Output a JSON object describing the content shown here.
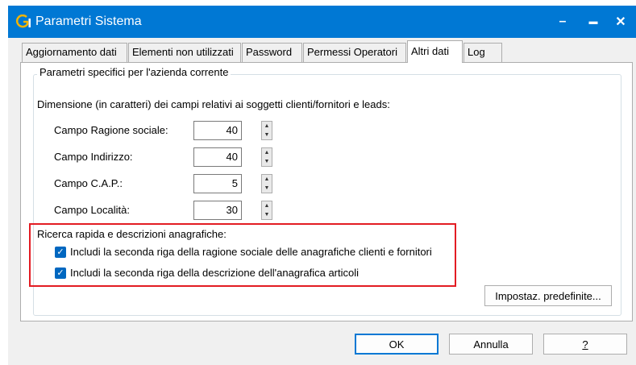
{
  "window": {
    "title": "Parametri Sistema",
    "minimize_glyph": "–",
    "maximize_glyph": "▬",
    "close_glyph": "✕",
    "titlebar_color": "#0078d4",
    "icon": "app-logo-icon"
  },
  "tabs": [
    {
      "label": "Aggiornamento dati",
      "active": false
    },
    {
      "label": "Elementi non utilizzati",
      "active": false
    },
    {
      "label": "Password",
      "active": false
    },
    {
      "label": "Permessi Operatori",
      "active": false
    },
    {
      "label": "Altri dati",
      "active": true
    },
    {
      "label": "Log",
      "active": false
    }
  ],
  "group": {
    "title": "Parametri specifici per l'azienda corrente",
    "dimension_heading": "Dimensione (in caratteri) dei campi relativi ai soggetti clienti/fornitori e leads:",
    "fields": [
      {
        "label": "Campo Ragione sociale:",
        "value": "40"
      },
      {
        "label": "Campo Indirizzo:",
        "value": "40"
      },
      {
        "label": "Campo C.A.P.:",
        "value": "5"
      },
      {
        "label": "Campo Località:",
        "value": "30"
      }
    ],
    "search_heading": "Ricerca rapida e descrizioni anagrafiche:",
    "checkboxes": [
      {
        "label": "Includi la seconda riga della ragione sociale delle anagrafiche clienti e fornitori",
        "checked": true
      },
      {
        "label": "Includi la seconda riga della descrizione dell'anagrafica articoli",
        "checked": true
      }
    ],
    "highlight_color": "#e31c23",
    "defaults_button": "Impostaz. predefinite..."
  },
  "footer": {
    "ok": "OK",
    "cancel": "Annulla",
    "help": "?"
  }
}
